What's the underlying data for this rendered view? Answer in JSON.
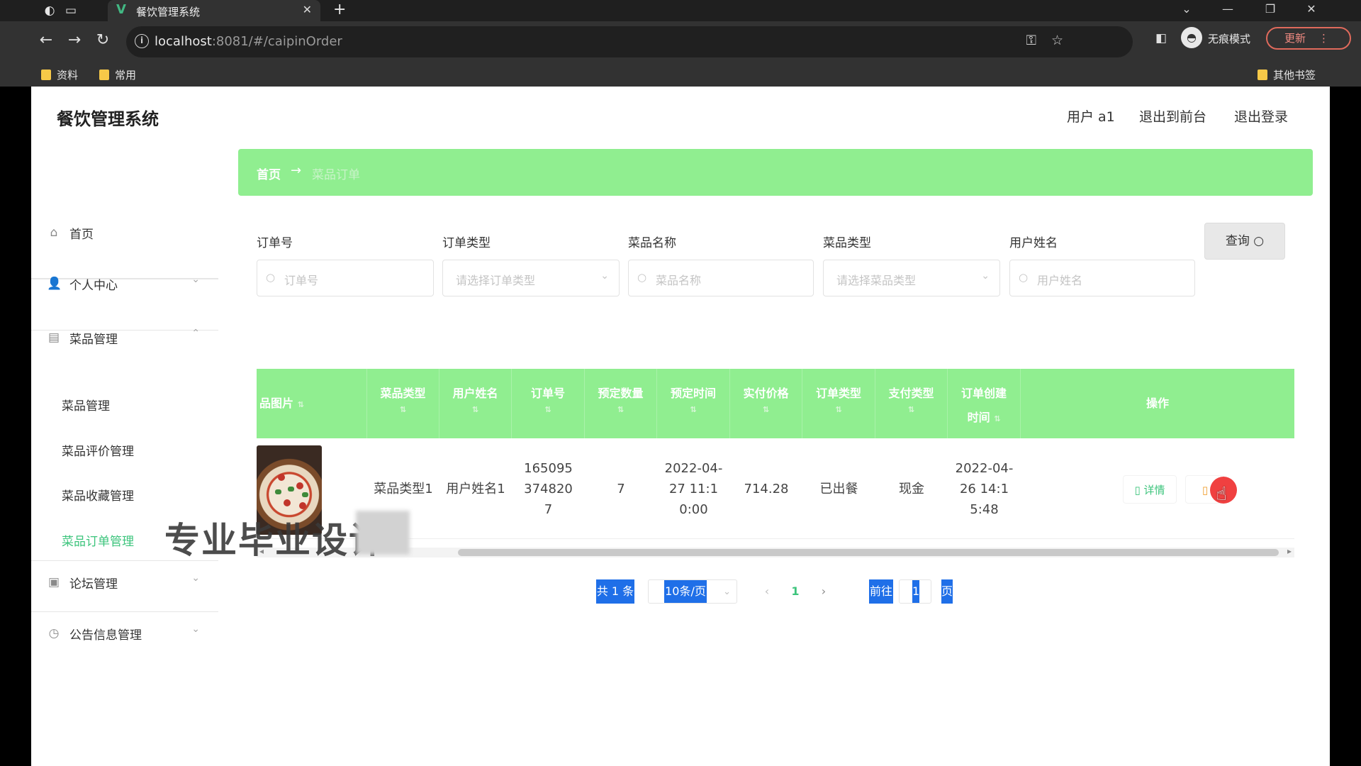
{
  "browser": {
    "tab_title": "餐饮管理系统",
    "url_host": "localhost",
    "url_rest": ":8081/#/caipinOrder",
    "incognito_label": "无痕模式",
    "update_label": "更新",
    "bookmarks": [
      "资料",
      "常用"
    ],
    "other_bookmarks": "其他书签"
  },
  "header": {
    "logo": "餐饮管理系统",
    "user": "用户 a1",
    "front": "退出到前台",
    "logout": "退出登录"
  },
  "sidebar": {
    "home": "首页",
    "personal": "个人中心",
    "dish_mgmt": "菜品管理",
    "subs": [
      "菜品管理",
      "菜品评价管理",
      "菜品收藏管理",
      "菜品订单管理"
    ],
    "forum": "论坛管理",
    "notice": "公告信息管理"
  },
  "breadcrumb": {
    "home": "首页",
    "sep": "→",
    "current": "菜品订单"
  },
  "filters": [
    {
      "label": "订单号",
      "placeholder": "订单号"
    },
    {
      "label": "订单类型",
      "placeholder": "请选择订单类型"
    },
    {
      "label": "菜品名称",
      "placeholder": "菜品名称"
    },
    {
      "label": "菜品类型",
      "placeholder": "请选择菜品类型"
    },
    {
      "label": "用户姓名",
      "placeholder": "用户姓名"
    }
  ],
  "query_label": "查询",
  "table": {
    "headers": [
      "品图片",
      "菜品类型",
      "用户姓名",
      "订单号",
      "预定数量",
      "预定时间",
      "实付价格",
      "订单类型",
      "支付类型",
      "订单创建时间",
      "操作"
    ],
    "row": {
      "type": "菜品类型1",
      "user": "用户姓名1",
      "order": "1650953748207",
      "qty": "7",
      "time": "2022-04-27 11:10:00",
      "price": "714.28",
      "order_type": "已出餐",
      "pay": "现金",
      "created": "2022-04-26 14:15:48",
      "detail": "详情"
    }
  },
  "pagination": {
    "total": "共 1 条",
    "size": "10条/页",
    "page": "1",
    "goto": "前往",
    "goto_value": "1",
    "page_suffix": "页"
  },
  "watermark": "专业毕业设计",
  "colors": {
    "accent": "#90ee90",
    "active": "#3cc47c",
    "blue": "#1f6fe8"
  }
}
